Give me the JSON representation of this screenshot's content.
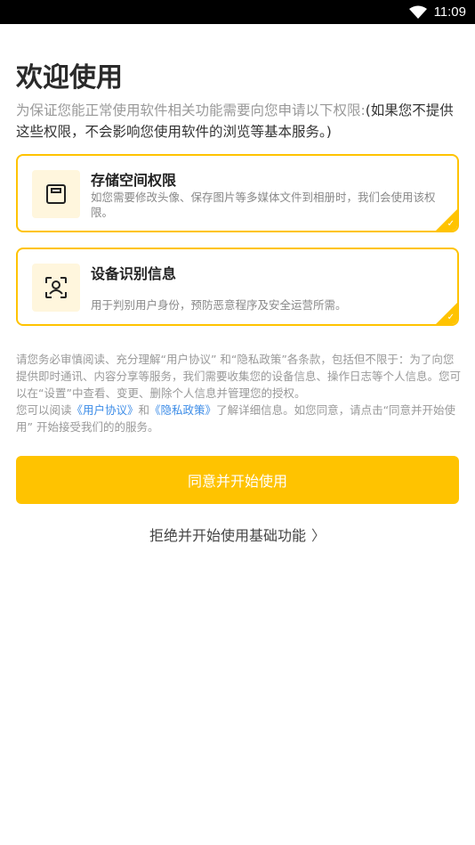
{
  "status_bar": {
    "time": "11:09",
    "icons": [
      "wifi-icon",
      "battery-icon"
    ]
  },
  "page": {
    "title": "欢迎使用",
    "intro_gray": "为保证您能正常使用软件相关功能需要向您申请以下权限:",
    "intro_dark": "(如果您不提供这些权限，不会影响您使用软件的浏览等基本服务。)"
  },
  "permissions": [
    {
      "icon": "storage-icon",
      "title": "存储空间权限",
      "description": "如您需要修改头像、保存图片等多媒体文件到相册时，我们会使用该权限。"
    },
    {
      "icon": "face-id-icon",
      "title": "设备识别信息",
      "description": "用于判别用户身份，预防恶意程序及安全运营所需。"
    }
  ],
  "agreement": {
    "paragraph1": "请您务必审慎阅读、充分理解“用户协议” 和“隐私政策”各条款，包括但不限于：为了向您提供即时通讯、内容分享等服务，我们需要收集您的设备信息、操作日志等个人信息。您可以在“设置”中查看、变更、删除个人信息并管理您的授权。",
    "p2_prefix": "您可以阅读",
    "user_agreement_link": "《用户协议》",
    "and": "和",
    "privacy_policy_link": "《隐私政策》",
    "p2_suffix": "了解详细信息。如您同意，请点击“同意并开始使用” 开始接受我们的的服务。"
  },
  "buttons": {
    "agree_label": "同意并开始使用",
    "reject_label": "拒绝并开始使用基础功能",
    "reject_chevron": "〉"
  },
  "colors": {
    "accent": "#FFC300",
    "icon_bg": "#FFF6DD",
    "link": "#3C8CE7"
  }
}
